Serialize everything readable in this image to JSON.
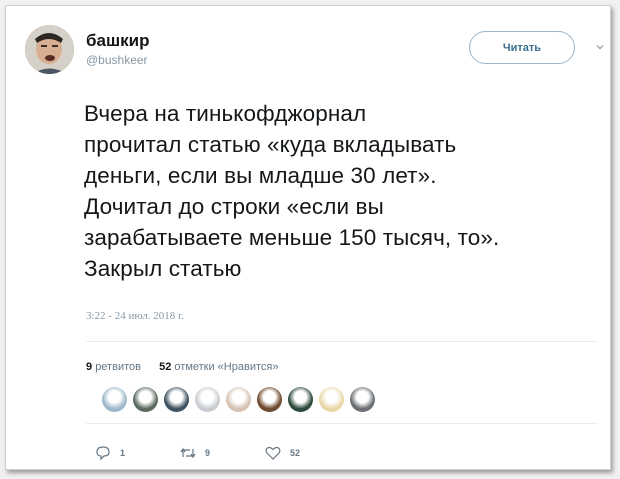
{
  "user": {
    "display_name": "башкир",
    "handle": "@bushkeer"
  },
  "follow_button_label": "Читать",
  "tweet": {
    "lines": [
      "Вчера на тинькофджорнал",
      "прочитал статью «куда вкладывать",
      "деньги, если вы младше 30 лет».",
      "Дочитал до строки «если вы",
      "зарабатываете меньше 150 тысяч, то».",
      "Закрыл статью"
    ],
    "timestamp": "3:22 - 24 июл. 2018 г."
  },
  "stats": {
    "retweets_count": "9",
    "retweets_label": "ретвитов",
    "likes_count": "52",
    "likes_label": "отметки «Нравится»"
  },
  "likers": [
    {
      "icon": "user-avatar",
      "color": "#9fb8c9"
    },
    {
      "icon": "user-avatar",
      "color": "#5b6a5e"
    },
    {
      "icon": "user-avatar",
      "color": "#3f5260"
    },
    {
      "icon": "user-avatar",
      "color": "#c9cdd1"
    },
    {
      "icon": "user-avatar",
      "color": "#d7c3b3"
    },
    {
      "icon": "user-avatar",
      "color": "#6e4a2f"
    },
    {
      "icon": "user-avatar",
      "color": "#2e4a3c"
    },
    {
      "icon": "user-avatar",
      "color": "#e8d8a8"
    },
    {
      "icon": "user-avatar",
      "color": "#6b6f73"
    }
  ],
  "actions": {
    "reply_count": "1",
    "retweet_count": "9",
    "like_count": "52"
  }
}
